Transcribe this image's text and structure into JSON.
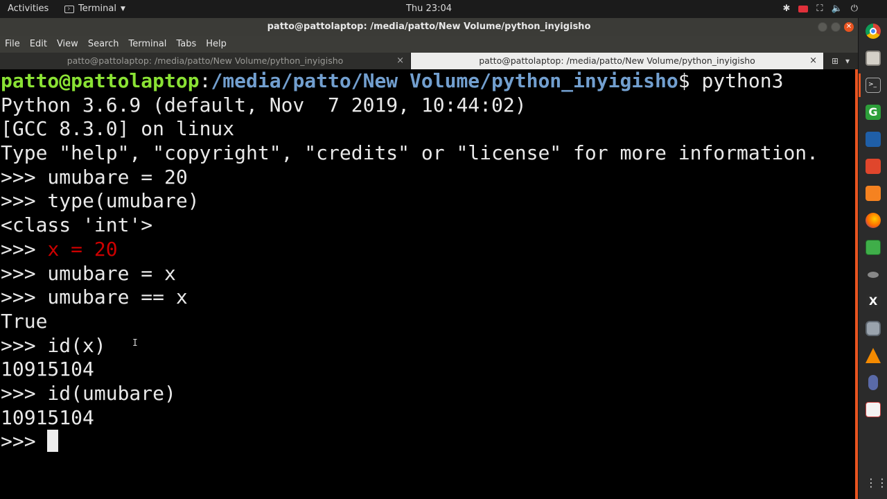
{
  "topbar": {
    "activities": "Activities",
    "app_name": "Terminal",
    "clock": "Thu 23:04"
  },
  "window": {
    "title": "patto@pattolaptop: /media/patto/New Volume/python_inyigisho",
    "menus": [
      "File",
      "Edit",
      "View",
      "Search",
      "Terminal",
      "Tabs",
      "Help"
    ],
    "tabs": [
      {
        "label": "patto@pattolaptop: /media/patto/New Volume/python_inyigisho",
        "active": false
      },
      {
        "label": "patto@pattolaptop: /media/patto/New Volume/python_inyigisho",
        "active": true
      }
    ]
  },
  "terminal": {
    "prompt_user": "patto@pattolaptop",
    "prompt_sep": ":",
    "prompt_path": "/media/patto/New Volume/python_inyigisho",
    "prompt_end": "$ python3",
    "lines": [
      "Python 3.6.9 (default, Nov  7 2019, 10:44:02) ",
      "[GCC 8.3.0] on linux",
      "Type \"help\", \"copyright\", \"credits\" or \"license\" for more information.",
      ">>> umubare = 20",
      ">>> type(umubare)",
      "<class 'int'>"
    ],
    "highlight_prefix": ">>> ",
    "highlight_code": "x = 20",
    "lines2": [
      ">>> umubare = x",
      ">>> umubare == x",
      "True",
      ">>> id(x)",
      "10915104",
      ">>> id(umubare)",
      "10915104"
    ],
    "final_prompt": ">>> "
  },
  "colors": {
    "prompt_user": "#8ae234",
    "prompt_path": "#729fcf",
    "highlight": "#cc0000",
    "accent": "#e95420"
  }
}
